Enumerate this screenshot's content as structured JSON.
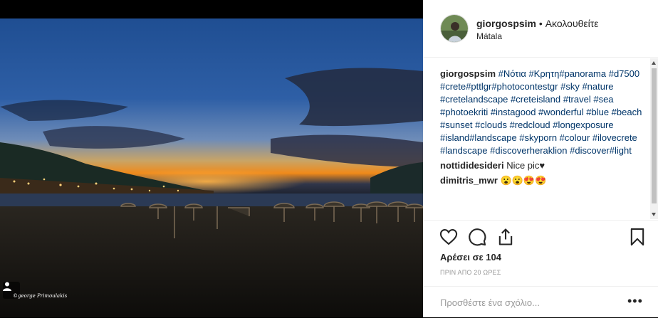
{
  "post": {
    "username": "giorgospsim",
    "follow_sep": " • ",
    "follow_label": "Ακολουθείτε",
    "location": "Mátala",
    "watermark": "©george Primoulakis"
  },
  "caption": {
    "author": "giorgospsim",
    "text": "#Νότια #Κρητη#panorama #d7500 #crete#pttlgr#photocontestgr #sky #nature #cretelandscape #creteisland #travel #sea #photoekriti #instagood #wonderful #blue #beach #sunset #clouds #redcloud #longexposure #island#landscape #skyporn #colour #ilovecrete #landscape #discoverheraklion #discover#light"
  },
  "comments": [
    {
      "author": "nottididesideri",
      "text": "Nice pic♥"
    },
    {
      "author": "dimitris_mwr",
      "text": "😮😮😍😍"
    }
  ],
  "likes": "Αρέσει σε 104",
  "time_ago": "ΠΡΙΝ ΑΠΟ 20 ΩΡΕΣ",
  "comment_box": {
    "placeholder": "Προσθέστε ένα σχόλιο...",
    "more": "•••"
  },
  "icons": {
    "like": "heart-icon",
    "comment": "comment-icon",
    "share": "share-icon",
    "save": "bookmark-icon",
    "user_tag": "user-icon"
  },
  "colors": {
    "link": "#003569",
    "text": "#262626",
    "muted": "#999999"
  }
}
